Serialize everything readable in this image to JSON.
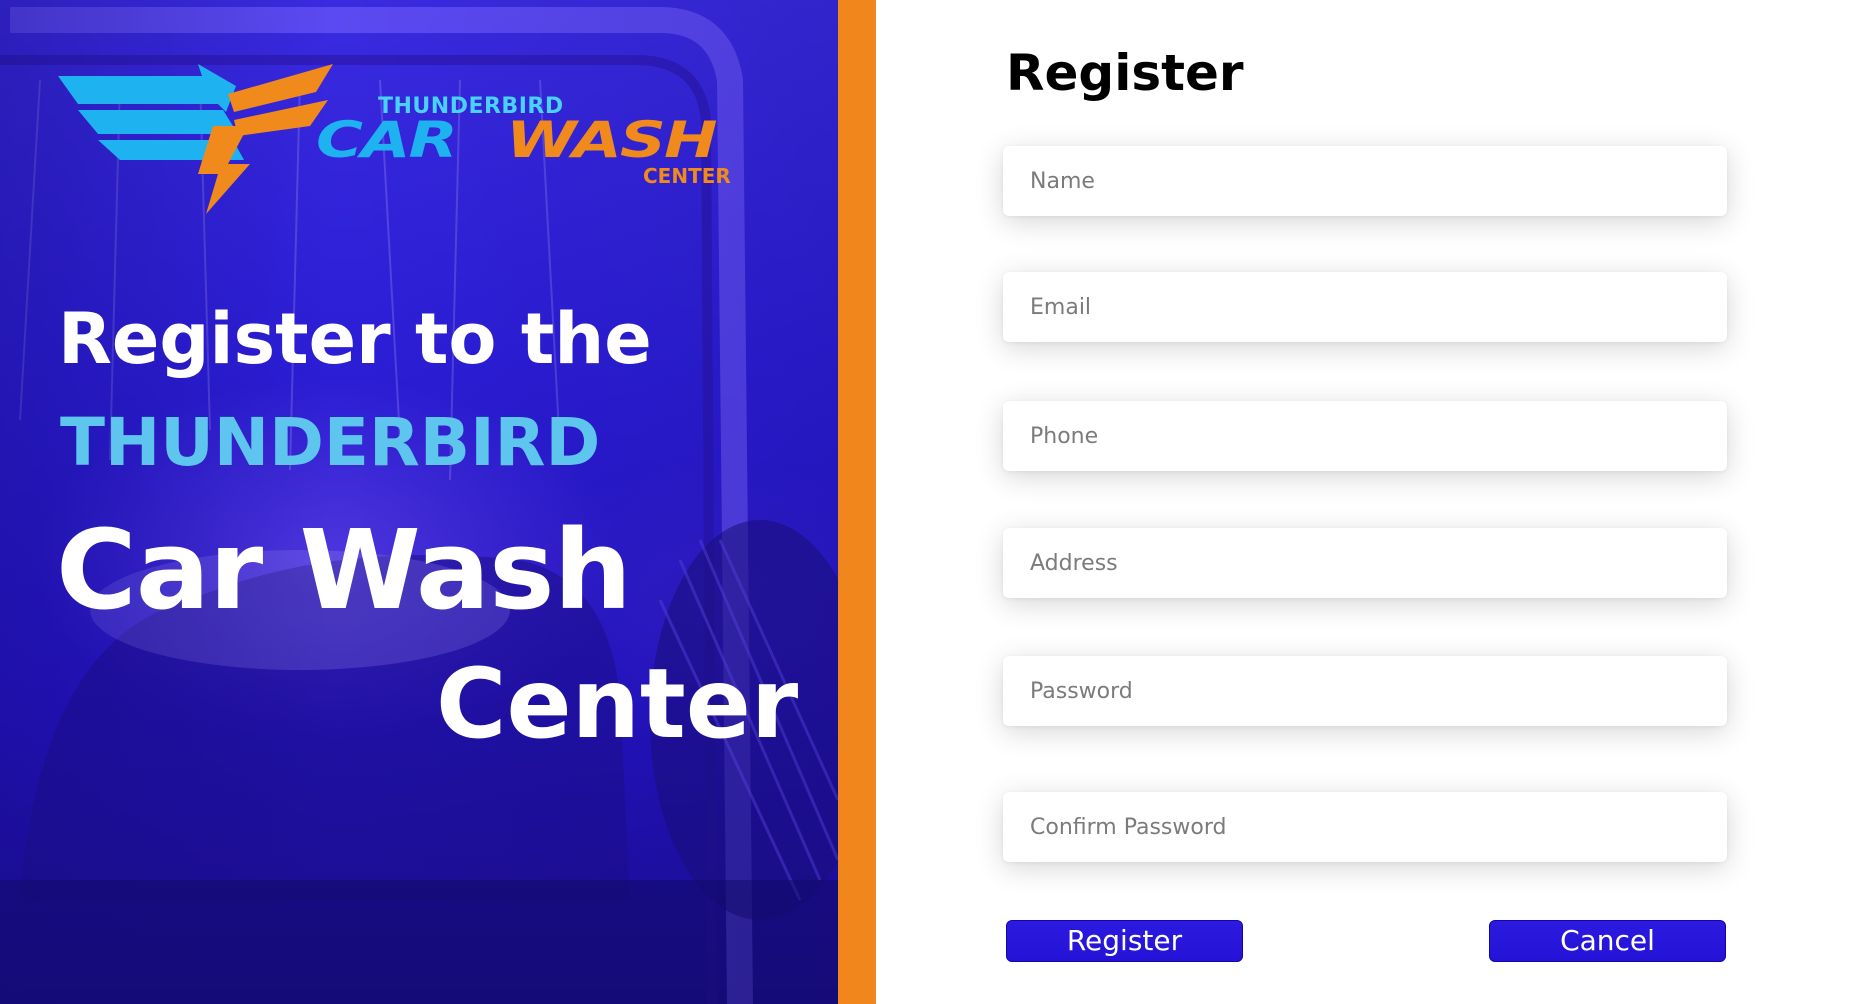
{
  "hero": {
    "logo": {
      "thunderbird": "THUNDERBIRD",
      "car": "CAR",
      "wash": "WASH",
      "center": "CENTER"
    },
    "headline_line1": "Register to the",
    "headline_line2": "THUNDERBIRD",
    "headline_line3": "Car Wash",
    "headline_line4": "Center"
  },
  "form": {
    "title": "Register",
    "fields": {
      "name": {
        "placeholder": "Name",
        "value": ""
      },
      "email": {
        "placeholder": "Email",
        "value": ""
      },
      "phone": {
        "placeholder": "Phone",
        "value": ""
      },
      "address": {
        "placeholder": "Address",
        "value": ""
      },
      "password": {
        "placeholder": "Password",
        "value": ""
      },
      "confirm_password": {
        "placeholder": "Confirm Password",
        "value": ""
      }
    },
    "register_label": "Register",
    "cancel_label": "Cancel"
  },
  "colors": {
    "accent_orange": "#f1871c",
    "button_blue": "#2412d6",
    "hero_blue": "#2c1ed6",
    "headline_cyan": "#5ec6ee"
  }
}
